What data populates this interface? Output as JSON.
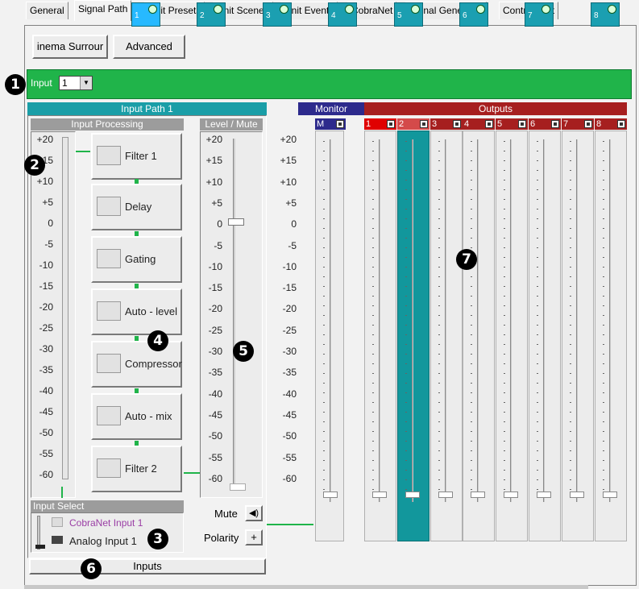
{
  "tabs": [
    "General",
    "Signal Path",
    "Unit Presets",
    "Unit Scenes",
    "Unit Events",
    "CobraNet",
    "Signal Generator",
    "Control Port"
  ],
  "active_tab": "Signal Path",
  "buttons": {
    "surround": "inema Surrour",
    "advanced": "Advanced"
  },
  "input_select": {
    "label": "Input",
    "value": "1"
  },
  "channels": [
    "1",
    "2",
    "3",
    "4",
    "5",
    "6",
    "7",
    "8"
  ],
  "callouts": [
    "1",
    "2",
    "3",
    "4",
    "5",
    "6",
    "7"
  ],
  "input_path": {
    "title": "Input Path 1",
    "processing_title": "Input Processing",
    "level_title": "Level / Mute",
    "blocks": [
      "Filter 1",
      "Delay",
      "Gating",
      "Auto - level",
      "Compressor",
      "Auto - mix",
      "Filter 2"
    ],
    "scale": [
      "+20",
      "+15",
      "+10",
      "+5",
      "0",
      "-5",
      "-10",
      "-15",
      "-20",
      "-25",
      "-30",
      "-35",
      "-40",
      "-45",
      "-50",
      "-55",
      "-60"
    ],
    "mute_label": "Mute",
    "polarity_label": "Polarity",
    "input_select_title": "Input Select",
    "sources": [
      "CobraNet Input 1",
      "Analog Input 1"
    ],
    "inputs_button": "Inputs"
  },
  "monitor": {
    "title": "Monitor",
    "channel": "M"
  },
  "outputs": {
    "title": "Outputs",
    "channels": [
      "1",
      "2",
      "3",
      "4",
      "5",
      "6",
      "7",
      "8"
    ],
    "selected": "2"
  },
  "colors": {
    "strip_green": "#20b44a",
    "teal": "#1a9ea7",
    "navy": "#2d2a8c",
    "red": "#a61f1f",
    "selected_input": "#27b9ff",
    "selected_output": "#12979c"
  }
}
